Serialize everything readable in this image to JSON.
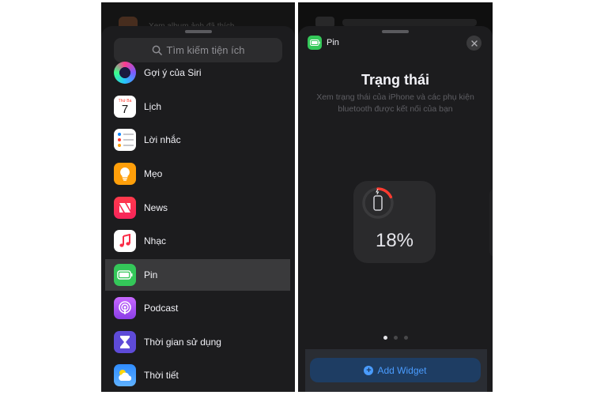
{
  "left": {
    "ghost_text": "Xem album ảnh đã thích",
    "search": {
      "placeholder": "Tìm kiếm tiện ích",
      "icon": "search-icon"
    },
    "calendar_icon": {
      "day_label": "Thứ Ba",
      "day_number": "7"
    },
    "apps": [
      {
        "label": "Gợi ý của Siri",
        "icon": "siri-icon"
      },
      {
        "label": "Lịch",
        "icon": "calendar-icon"
      },
      {
        "label": "Lời nhắc",
        "icon": "reminders-icon"
      },
      {
        "label": "Mẹo",
        "icon": "tips-icon"
      },
      {
        "label": "News",
        "icon": "news-icon"
      },
      {
        "label": "Nhạc",
        "icon": "music-icon"
      },
      {
        "label": "Pin",
        "icon": "battery-icon",
        "selected": true
      },
      {
        "label": "Podcast",
        "icon": "podcast-icon"
      },
      {
        "label": "Thời gian sử dụng",
        "icon": "screen-time-icon"
      },
      {
        "label": "Thời tiết",
        "icon": "weather-icon"
      }
    ]
  },
  "right": {
    "header": {
      "app_name": "Pin",
      "icon": "battery-icon",
      "close_icon": "close-icon"
    },
    "widget_title": "Trạng thái",
    "widget_description": "Xem trạng thái của iPhone và các phụ kiện bluetooth được kết nối của bạn",
    "widget": {
      "battery_percent": "18%",
      "battery_level": 0.18,
      "ring_color": "#ff3b30"
    },
    "page_dots": {
      "count": 3,
      "active": 0
    },
    "add_widget_label": "Add Widget"
  },
  "colors": {
    "background": "#1c1c1e",
    "selected_row": "#3a3a3c",
    "accent_blue": "#4a9cff",
    "battery_green": "#34c759"
  }
}
